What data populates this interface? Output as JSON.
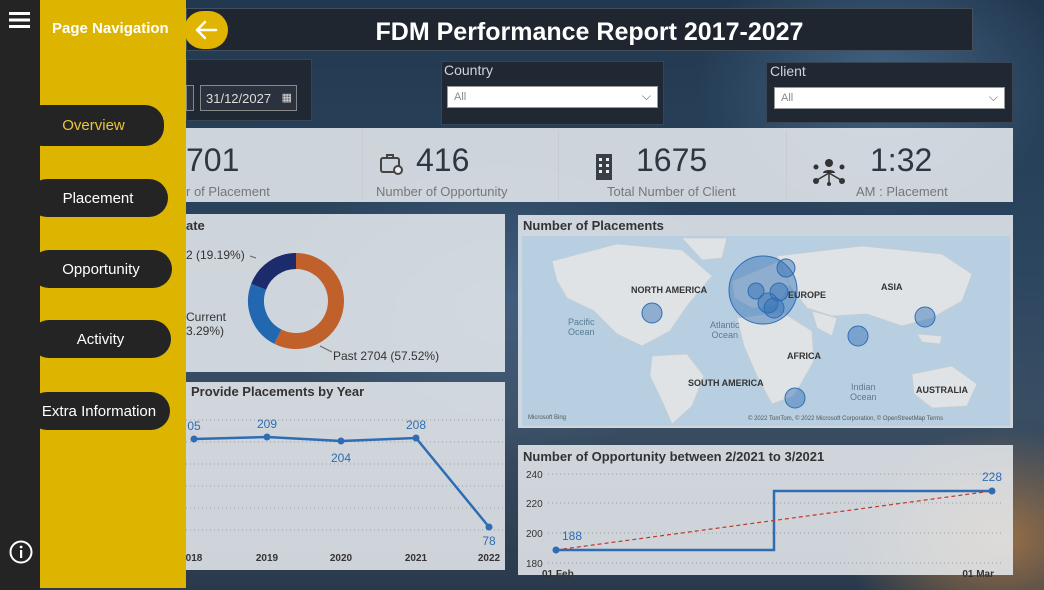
{
  "header": {
    "title": "FDM Performance Report 2017-2027"
  },
  "filters": {
    "date_end": "31/12/2027",
    "country": {
      "label": "Country",
      "value": "All"
    },
    "client": {
      "label": "Client",
      "value": "All"
    }
  },
  "kpis": [
    {
      "value": "701",
      "label": "r of Placement"
    },
    {
      "value": "416",
      "label": "Number of Opportunity"
    },
    {
      "value": "1675",
      "label": "Total Number of Client"
    },
    {
      "value": "1:32",
      "label": "AM : Placement"
    }
  ],
  "donut": {
    "title": "ate",
    "labels": {
      "top": "2 (19.19%)",
      "left1": "Current",
      "left2": "3.29%)",
      "bottom": "Past 2704 (57.52%)"
    }
  },
  "map": {
    "title": "Number of Placements",
    "labels": {
      "na": "NORTH AMERICA",
      "eu": "EUROPE",
      "asia": "ASIA",
      "africa": "AFRICA",
      "sa": "SOUTH AMERICA",
      "aus": "AUSTRALIA",
      "pacific1": "Pacific",
      "pacific2": "Ocean",
      "atl1": "Atlantic",
      "atl2": "Ocean",
      "ind1": "Indian",
      "ind2": "Ocean"
    },
    "brand": "Microsoft Bing",
    "copyright": "© 2022 TomTom, © 2022 Microsoft Corporation, © OpenStreetMap Terms"
  },
  "year_chart": {
    "title": "Provide Placements by Year",
    "x_labels": [
      "018",
      "2019",
      "2020",
      "2021",
      "2022"
    ],
    "point_labels": [
      "05",
      "209",
      "204",
      "208",
      "78"
    ]
  },
  "opp_chart": {
    "title": "Number of Opportunity between 2/2021 to 3/2021",
    "y_ticks": [
      "240",
      "220",
      "200",
      "180"
    ],
    "x_labels": [
      "01 Feb",
      "01 Mar"
    ],
    "point_labels": [
      "188",
      "228"
    ]
  },
  "nav": {
    "title": "Page Navigation",
    "items": [
      "Overview",
      "Placement",
      "Opportunity",
      "Activity",
      "Extra Information"
    ]
  },
  "colors": {
    "accent": "#ddb500",
    "line": "#2e6db3",
    "trend": "#c0392b",
    "donut_orange": "#c0602a",
    "donut_blue": "#2168b0",
    "donut_navy": "#1c2b6b"
  }
}
